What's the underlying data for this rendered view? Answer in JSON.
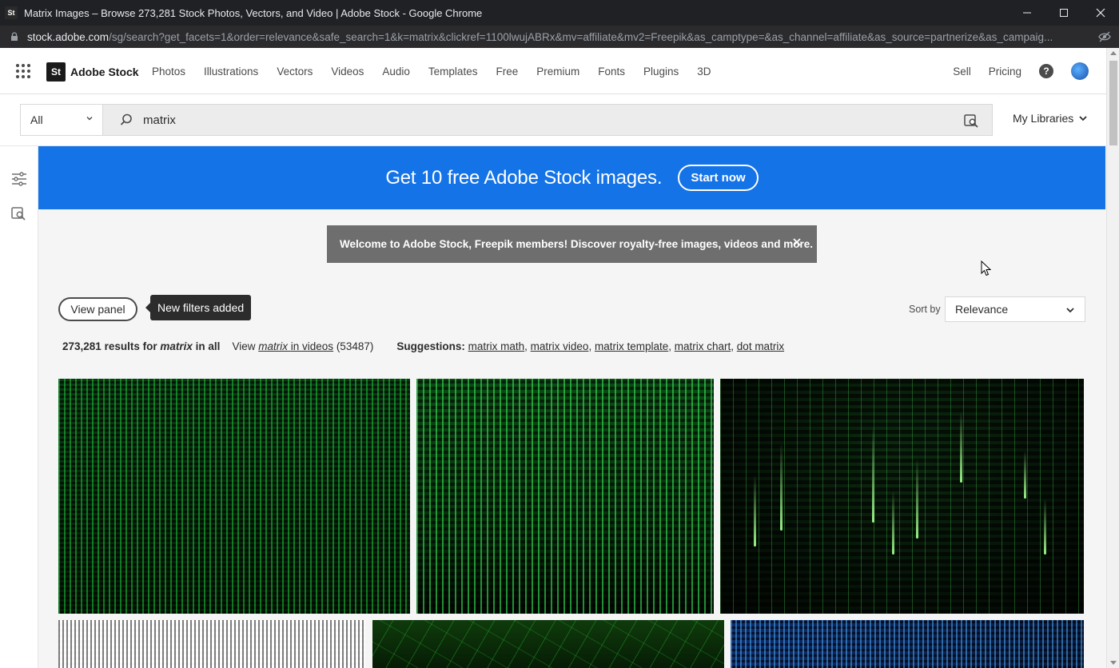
{
  "browser": {
    "tab_title": "Matrix Images – Browse 273,281 Stock Photos, Vectors, and Video | Adobe Stock - Google Chrome",
    "favicon_text": "St",
    "url_host": "stock.adobe.com",
    "url_rest": "/sg/search?get_facets=1&order=relevance&safe_search=1&k=matrix&clickref=1100lwujABRx&mv=affiliate&mv2=Freepik&as_camptype=&as_channel=affiliate&as_source=partnerize&as_campaig..."
  },
  "header": {
    "logo_mark": "St",
    "logo_text": "Adobe Stock",
    "nav": [
      "Photos",
      "Illustrations",
      "Vectors",
      "Videos",
      "Audio",
      "Templates",
      "Free",
      "Premium",
      "Fonts",
      "Plugins",
      "3D"
    ],
    "sell": "Sell",
    "pricing": "Pricing",
    "help": "?"
  },
  "search": {
    "scope": "All",
    "query": "matrix",
    "my_libraries": "My Libraries"
  },
  "banner": {
    "text": "Get 10 free Adobe Stock images.",
    "cta": "Start now"
  },
  "toast": {
    "text": "Welcome to Adobe Stock, Freepik members! Discover royalty-free images, videos and more."
  },
  "filters": {
    "view_panel": "View panel",
    "tooltip": "New filters added",
    "sort_label": "Sort by",
    "sort_value": "Relevance"
  },
  "results": {
    "count": "273,281",
    "for_label": "results for",
    "term": "matrix",
    "in_all": "in all",
    "view_label": "View",
    "view_link_term": "matrix",
    "view_link_rest": "in videos",
    "video_count": "(53487)",
    "suggestions_label": "Suggestions:",
    "suggestions": [
      "matrix math",
      "matrix video",
      "matrix template",
      "matrix chart",
      "dot matrix"
    ]
  },
  "icons": {
    "apps": "apps-grid-icon",
    "filters": "filter-sliders-icon",
    "visual_search": "visual-search-icon",
    "search": "search-icon",
    "close": "close-icon",
    "chevron": "chevron-down-icon"
  },
  "colors": {
    "banner": "#1473e6",
    "toast": "#6e6e6e",
    "matrix_green": "#2ecc40"
  }
}
